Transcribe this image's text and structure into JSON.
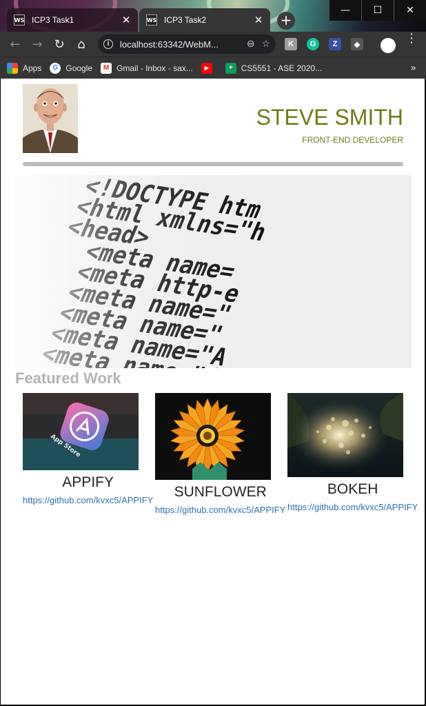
{
  "browser": {
    "tabs": [
      {
        "label": "ICP3 Task1",
        "icon": "webstorm-icon",
        "active": false
      },
      {
        "label": "ICP3 Task2",
        "icon": "webstorm-icon",
        "active": true
      }
    ],
    "url": "localhost:63342/WebM...",
    "bookmarks": [
      {
        "label": "Apps",
        "icon": "apps-grid-icon"
      },
      {
        "label": "Google",
        "icon": "google-icon"
      },
      {
        "label": "Gmail - Inbox - sax...",
        "icon": "gmail-icon"
      },
      {
        "label": "",
        "icon": "youtube-icon"
      },
      {
        "label": "CS5551 - ASE 2020...",
        "icon": "sheets-icon"
      }
    ],
    "window_controls": [
      "minimize",
      "maximize",
      "close"
    ]
  },
  "header": {
    "name": "STEVE SMITH",
    "role": "FRONT-END DEVELOPER"
  },
  "hero": {
    "code_lines": [
      "<!DOCTYPE htm",
      "<html xmlns=\"h",
      "<head>",
      "  <meta name=",
      "  <meta http-e",
      "  <meta name=\"",
      "  <meta name=\"",
      "  <meta name=\"A",
      "  <meta name=\"d"
    ]
  },
  "featured": {
    "heading": "Featured Work",
    "items": [
      {
        "title": "APPIFY",
        "link": "https://github.com/kvxc5/APPIFY"
      },
      {
        "title": "SUNFLOWER",
        "link": "https://github.com/kvxc5/APPIFY"
      },
      {
        "title": "BOKEH",
        "link": "https://github.com/kvxc5/APPIFY"
      }
    ]
  },
  "colors": {
    "accent": "#6f7a15",
    "link": "#2c6fb0",
    "heading_grey": "#b4b4b4"
  }
}
